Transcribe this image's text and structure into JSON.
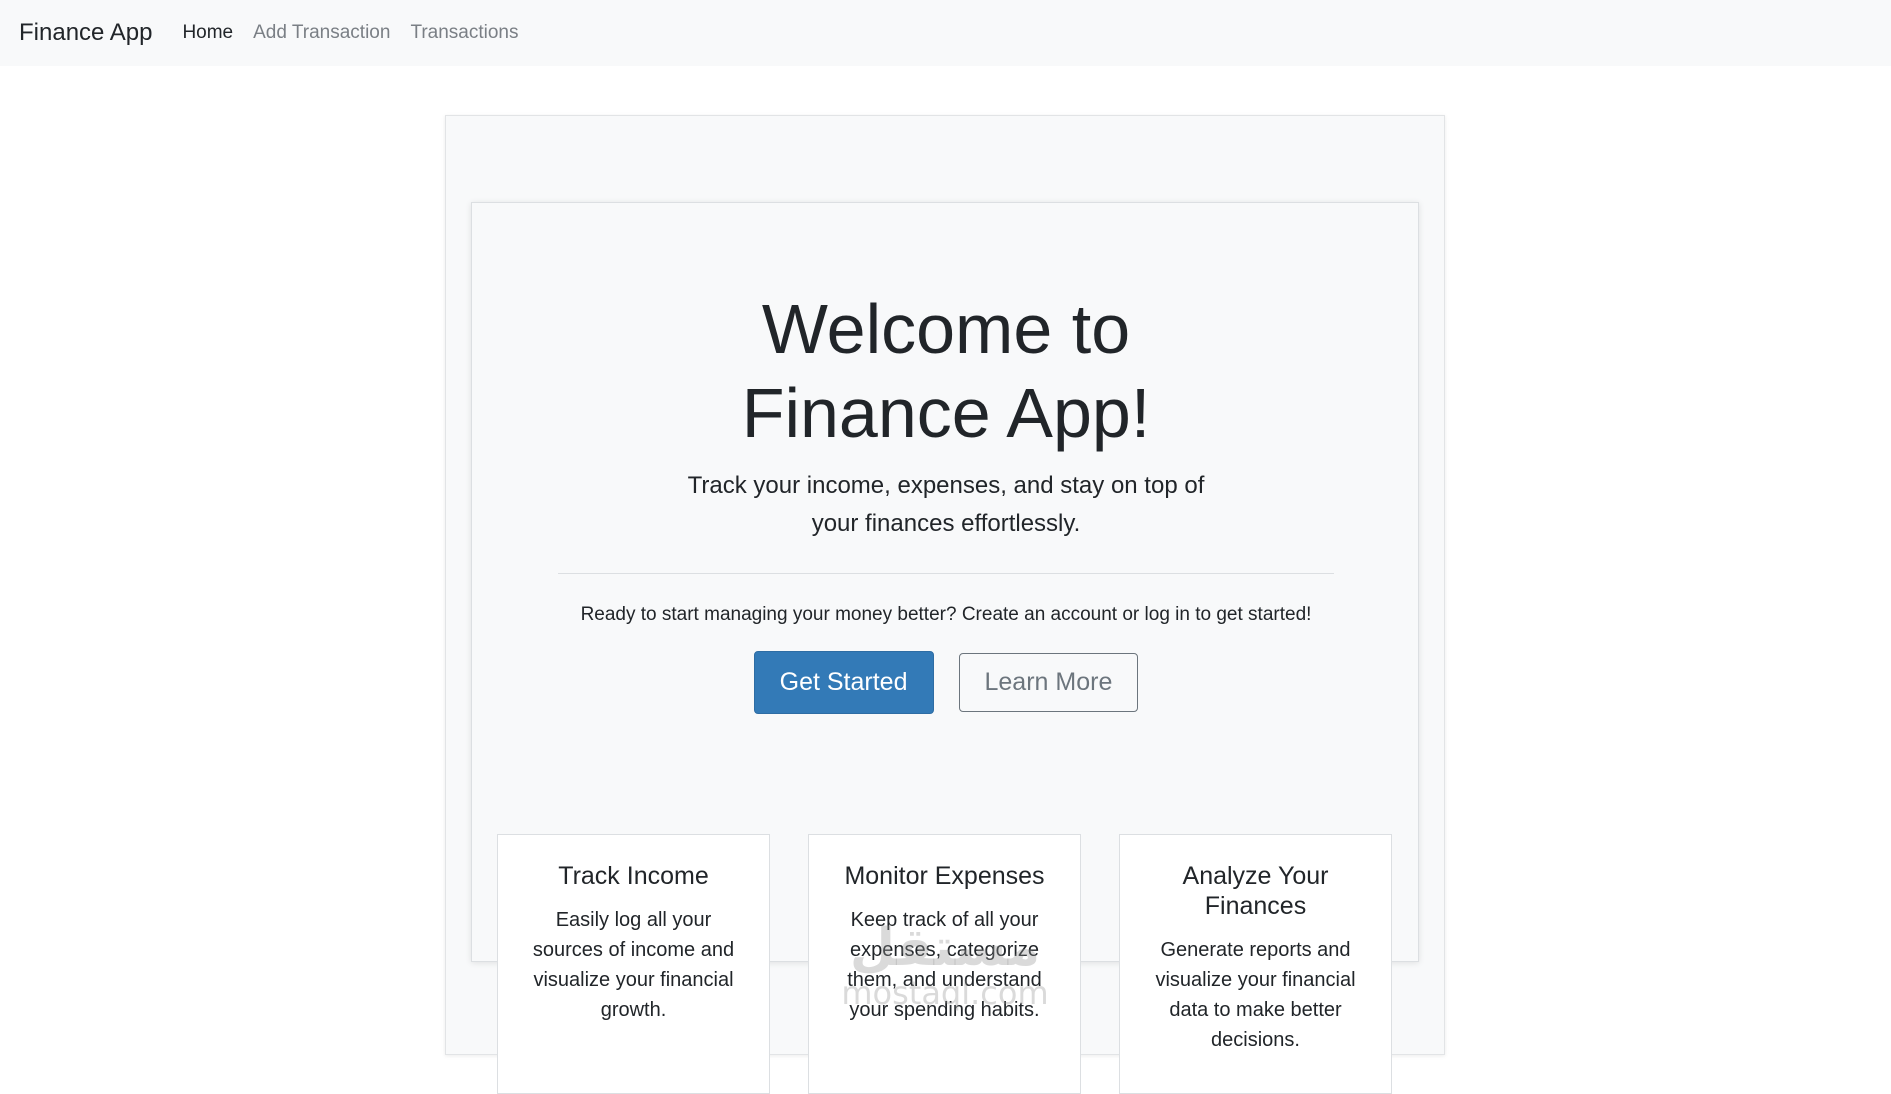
{
  "navbar": {
    "brand": "Finance App",
    "links": [
      {
        "label": "Home",
        "active": true
      },
      {
        "label": "Add Transaction",
        "active": false
      },
      {
        "label": "Transactions",
        "active": false
      }
    ]
  },
  "hero": {
    "title": "Welcome to Finance App!",
    "lead": "Track your income, expenses, and stay on top of your finances effortlessly.",
    "prompt": "Ready to start managing your money better? Create an account or log in to get started!",
    "primary_button": "Get Started",
    "secondary_button": "Learn More"
  },
  "features": [
    {
      "title": "Track Income",
      "text": "Easily log all your sources of income and visualize your financial growth."
    },
    {
      "title": "Monitor Expenses",
      "text": "Keep track of all your expenses, categorize them, and understand your spending habits."
    },
    {
      "title": "Analyze Your Finances",
      "text": "Generate reports and visualize your financial data to make better decisions."
    }
  ],
  "watermark": {
    "top": "مستقل",
    "bottom": "mostaql.com"
  },
  "colors": {
    "primary": "#337ab7",
    "navbar_bg": "#f8f9fa",
    "muted": "#6c757d"
  }
}
